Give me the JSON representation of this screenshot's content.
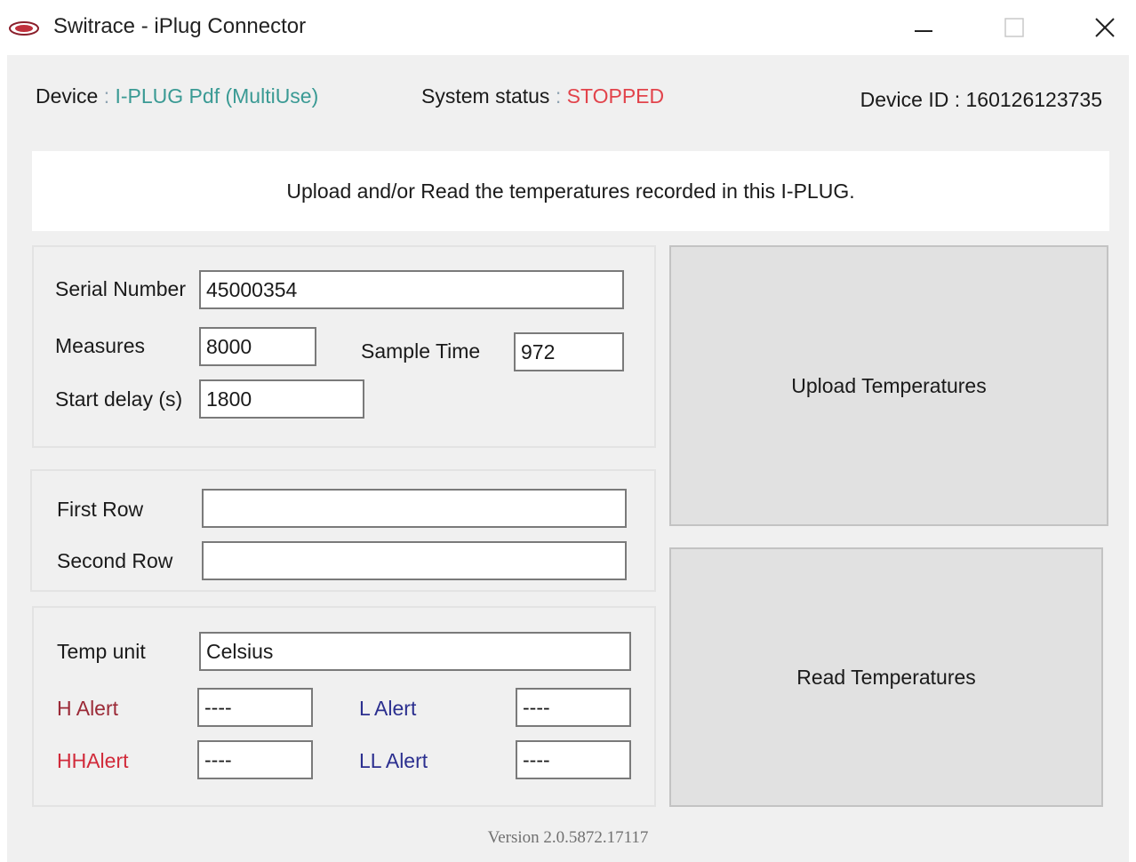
{
  "window": {
    "title": "Switrace - iPlug Connector",
    "logo_icon": "switrace-logo-icon",
    "controls": [
      "minimize-icon",
      "maximize-icon",
      "close-icon"
    ]
  },
  "header": {
    "device_label": "Device",
    "device_value": "I-PLUG Pdf (MultiUse)",
    "status_label": "System status",
    "status_value": "STOPPED",
    "device_id_label": "Device ID",
    "device_id_value": "160126123735",
    "separator": ":"
  },
  "message": "Upload and/or Read the temperatures recorded in this I-PLUG.",
  "settings": {
    "serial_label": "Serial Number",
    "serial_value": "45000354",
    "measures_label": "Measures",
    "measures_value": "8000",
    "sample_time_label": "Sample Time",
    "sample_time_value": "972",
    "start_delay_label": "Start delay (s)",
    "start_delay_value": "1800"
  },
  "rows": {
    "first_label": "First Row",
    "first_value": "",
    "second_label": "Second Row",
    "second_value": ""
  },
  "alerts": {
    "temp_unit_label": "Temp unit",
    "temp_unit_value": "Celsius",
    "h_alert_label": "H Alert",
    "h_alert_value": "----",
    "hh_alert_label": "HHAlert",
    "hh_alert_value": "----",
    "l_alert_label": "L Alert",
    "l_alert_value": "----",
    "ll_alert_label": "LL Alert",
    "ll_alert_value": "----"
  },
  "buttons": {
    "upload": "Upload Temperatures",
    "read": "Read Temperatures"
  },
  "footer": {
    "version": "Version 2.0.5872.17117"
  },
  "colors": {
    "device_value": "#3a9a94",
    "status_stopped": "#e2434b",
    "high_alert": "#9b2a37",
    "highhigh_alert": "#d12a3a",
    "low_alert": "#2b2f8f",
    "window_bg": "#f0f0f0"
  }
}
